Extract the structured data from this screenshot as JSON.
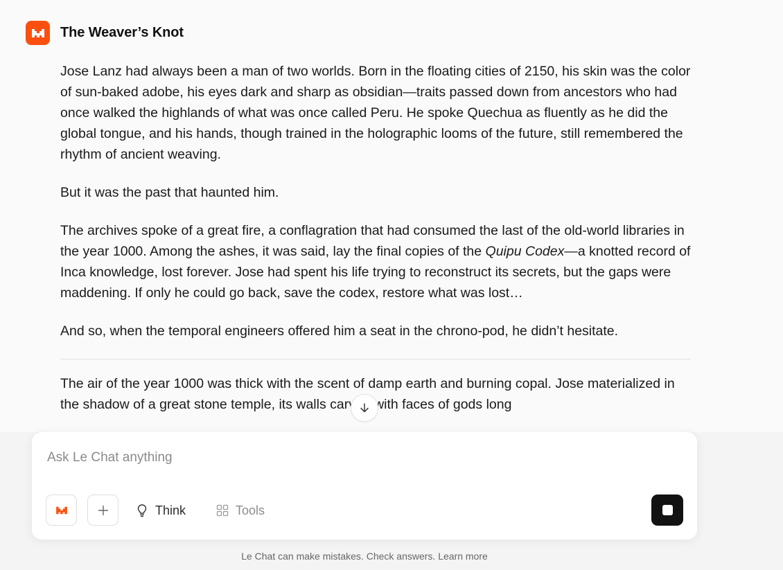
{
  "message": {
    "title": "The Weaver’s Knot",
    "paragraphs": {
      "p1": "Jose Lanz had always been a man of two worlds. Born in the floating cities of 2150, his skin was the color of sun-baked adobe, his eyes dark and sharp as obsidian—traits passed down from ancestors who had once walked the highlands of what was once called Peru. He spoke Quechua as fluently as he did the global tongue, and his hands, though trained in the holographic looms of the future, still remembered the rhythm of ancient weaving.",
      "p2": "But it was the past that haunted him.",
      "p3_before": "The archives spoke of a great fire, a conflagration that had consumed the last of the old-world libraries in the year 1000. Among the ashes, it was said, lay the final copies of the ",
      "p3_italic": "Quipu Codex",
      "p3_after": "—a knotted record of Inca knowledge, lost forever. Jose had spent his life trying to reconstruct its secrets, but the gaps were maddening. If only he could go back, save the codex, restore what was lost…",
      "p4": "And so, when the temporal engineers offered him a seat in the chrono-pod, he didn’t hesitate.",
      "p5": "The air of the year 1000 was thick with the scent of damp earth and burning copal. Jose materialized in the shadow of a great stone temple, its walls carved with faces of gods long"
    }
  },
  "composer": {
    "placeholder": "Ask Le Chat anything",
    "think_label": "Think",
    "tools_label": "Tools"
  },
  "footer": {
    "disclaimer": "Le Chat can make mistakes. Check answers. Learn more"
  },
  "colors": {
    "brand": "#fa500f",
    "stop_button": "#121212"
  },
  "icons": {
    "header_avatar": "mistral-logo-icon",
    "scroll": "arrow-down-icon",
    "think": "lightbulb-icon",
    "tools": "grid-icon",
    "plus": "plus-icon",
    "stop": "stop-icon"
  }
}
